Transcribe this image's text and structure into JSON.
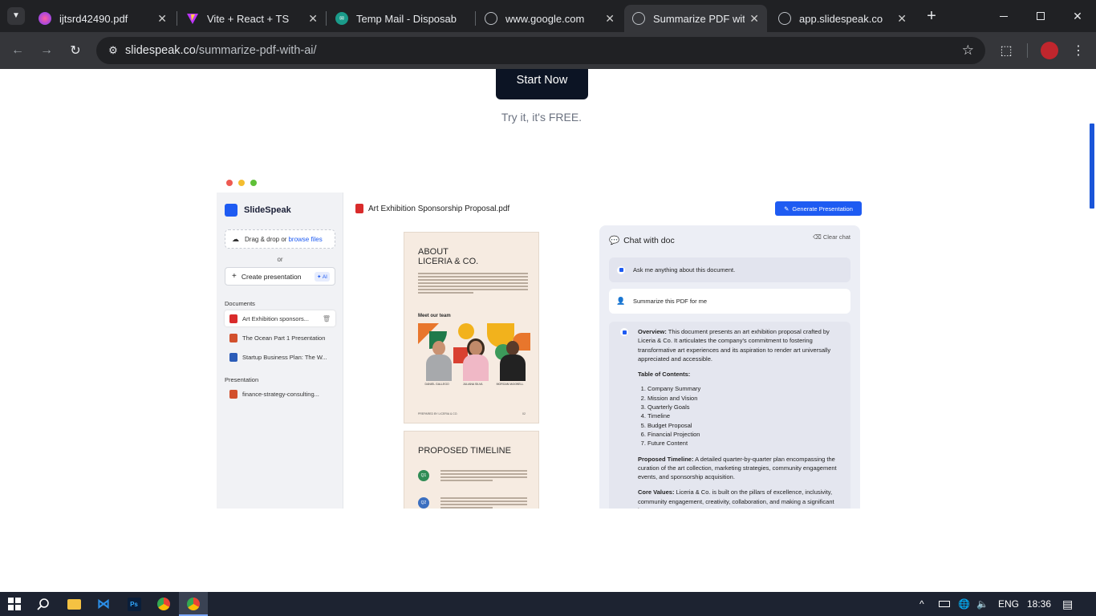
{
  "browser": {
    "tabs": [
      {
        "title": "ijtsrd42490.pdf",
        "icon": "firefox-like-icon",
        "color": "#a235e8"
      },
      {
        "title": "Vite + React + TS",
        "icon": "vite-icon",
        "color": "#bd34fe"
      },
      {
        "title": "Temp Mail - Disposab",
        "icon": "tempmail-icon",
        "color": "#1a9b8a"
      },
      {
        "title": "www.google.com",
        "icon": "globe-icon",
        "color": "#9aa0a6"
      },
      {
        "title": "Summarize PDF with",
        "icon": "globe-icon",
        "color": "#9aa0a6"
      },
      {
        "title": "app.slidespeak.co",
        "icon": "globe-icon",
        "color": "#9aa0a6"
      }
    ],
    "new_tab": "+",
    "url_domain": "slidespeak.co",
    "url_path": "/summarize-pdf-with-ai/",
    "close": "✕"
  },
  "page": {
    "start_button": "Start Now",
    "try_free": "Try it, it's FREE."
  },
  "mock": {
    "logo": "SlideSpeak",
    "drag_text": "Drag & drop or ",
    "browse": "browse files",
    "or": "or",
    "create": "Create presentation",
    "ai": "AI",
    "documents_heading": "Documents",
    "documents": [
      {
        "label": "Art Exhibition sponsors...",
        "type": "pdf",
        "color": "#d92b2b"
      },
      {
        "label": "The Ocean Part 1 Presentation",
        "type": "ppt",
        "color": "#d2502d"
      },
      {
        "label": "Startup Business Plan: The W...",
        "type": "doc",
        "color": "#2b5cb8"
      }
    ],
    "presentation_heading": "Presentation",
    "presentations": [
      {
        "label": "finance-strategy-consulting...",
        "type": "ppt",
        "color": "#d2502d"
      }
    ],
    "pdf_title": "Art Exhibition Sponsorship Proposal.pdf",
    "generate": "Generate Presentation",
    "pdf": {
      "about_l1": "ABOUT",
      "about_l2": "LICERIA & CO.",
      "meet": "Meet our team",
      "names": [
        "DANIEL GALLEGO",
        "JULIANA SILVA",
        "MORGAN MAXWELL"
      ],
      "footer_left": "PREPARED BY LICERIA & CO.",
      "footer_right": "02",
      "timeline": "PROPOSED TIMELINE",
      "q1": "Q1",
      "q2": "Q2"
    },
    "chat": {
      "title": "Chat with doc",
      "clear": "Clear chat",
      "bot_hint": "Ask me anything about this document.",
      "user_msg": "Summarize this PDF for me",
      "overview_label": "Overview:",
      "overview": " This document presents an art exhibition proposal crafted by Liceria & Co. It articulates the company's commitment to fostering transformative art experiences and its aspiration to render art universally appreciated and accessible.",
      "toc_label": "Table of Contents:",
      "toc": [
        "Company Summary",
        "Mission and Vision",
        "Quarterly Goals",
        "Timeline",
        "Budget Proposal",
        "Financial Projection",
        "Future Content"
      ],
      "timeline_label": "Proposed Timeline:",
      "timeline": " A detailed quarter-by-quarter plan encompassing the curation of the art collection, marketing strategies, community engagement events, and sponsorship acquisition.",
      "values_label": "Core Values:",
      "values": " Liceria & Co. is built on the pillars of excellence, inclusivity, community engagement, creativity, collaboration, and making a significant impact."
    }
  },
  "taskbar": {
    "lang": "ENG",
    "time": "18:36"
  }
}
